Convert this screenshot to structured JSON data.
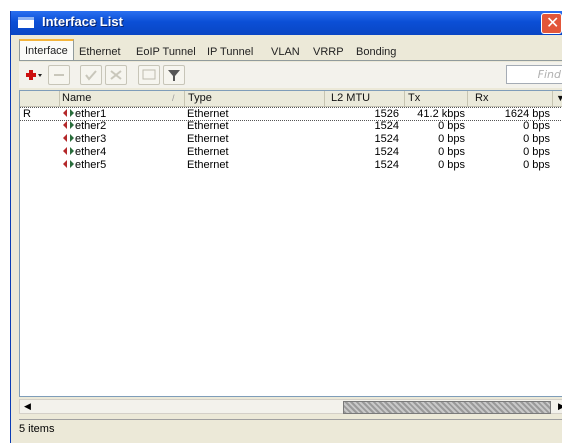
{
  "window": {
    "title": "Interface List"
  },
  "tabs": [
    "Interface",
    "Ethernet",
    "EoIP Tunnel",
    "IP Tunnel",
    "VLAN",
    "VRRP",
    "Bonding"
  ],
  "toolbar": {
    "find_placeholder": "Find"
  },
  "table": {
    "columns": [
      "Name",
      "Type",
      "L2 MTU",
      "Tx",
      "Rx"
    ],
    "rows": [
      {
        "flag": "R",
        "name": "ether1",
        "type": "Ethernet",
        "mtu": "1526",
        "tx": "41.2 kbps",
        "rx": "1624 bps"
      },
      {
        "flag": "",
        "name": "ether2",
        "type": "Ethernet",
        "mtu": "1524",
        "tx": "0 bps",
        "rx": "0 bps"
      },
      {
        "flag": "",
        "name": "ether3",
        "type": "Ethernet",
        "mtu": "1524",
        "tx": "0 bps",
        "rx": "0 bps"
      },
      {
        "flag": "",
        "name": "ether4",
        "type": "Ethernet",
        "mtu": "1524",
        "tx": "0 bps",
        "rx": "0 bps"
      },
      {
        "flag": "",
        "name": "ether5",
        "type": "Ethernet",
        "mtu": "1524",
        "tx": "0 bps",
        "rx": "0 bps"
      }
    ]
  },
  "status": {
    "text": "5 items"
  },
  "icons": [
    "window-icon",
    "close-icon",
    "add-icon",
    "remove-icon",
    "enable-icon",
    "disable-icon",
    "comment-icon",
    "filter-icon",
    "column-menu-icon",
    "interface-icon",
    "scroll-left-icon",
    "scroll-right-icon"
  ],
  "colors": {
    "title_bar": "#0b4fd6",
    "close_button": "#e2563a",
    "add_icon": "#cc1010",
    "active_tab_accent": "#f4b53c"
  }
}
